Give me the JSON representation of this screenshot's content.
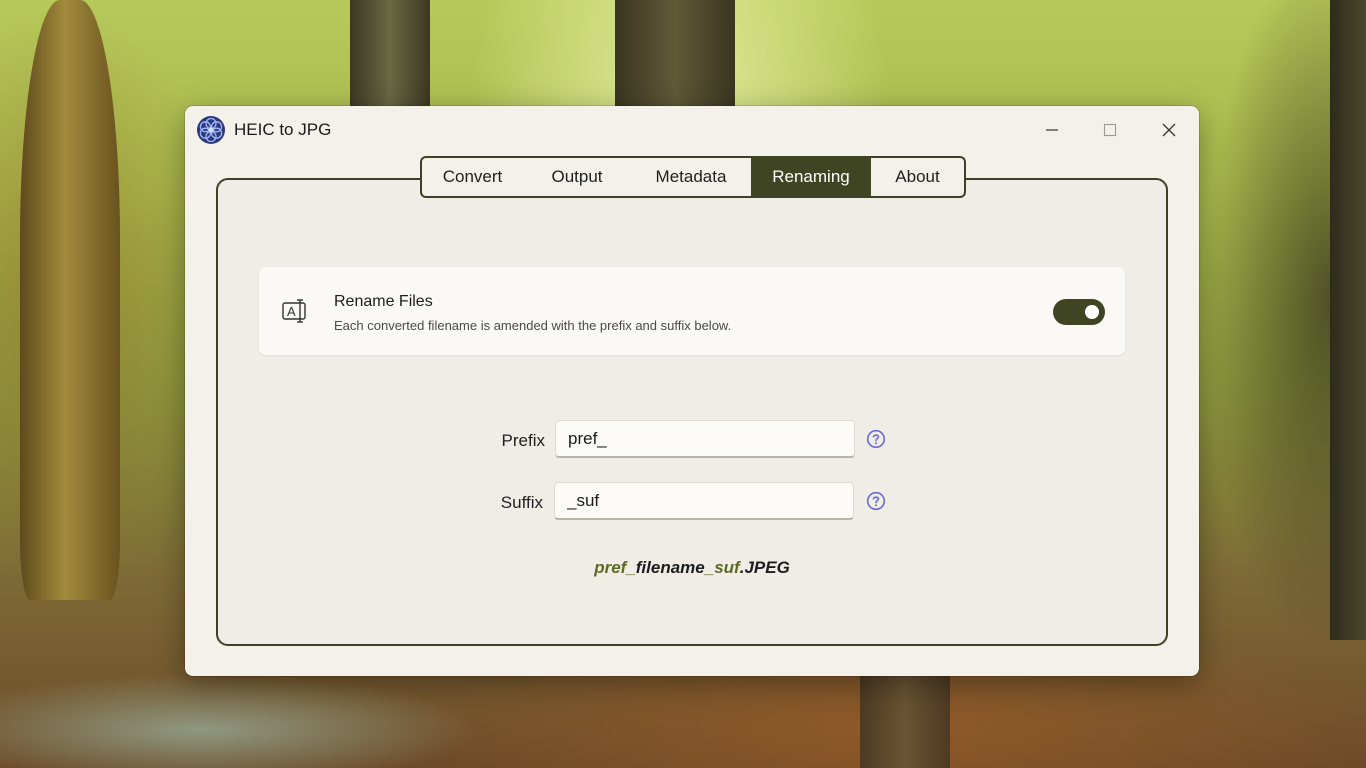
{
  "window": {
    "title": "HEIC to JPG",
    "app_icon": "flower-logo-icon",
    "controls": {
      "minimize_icon": "minimize-icon",
      "maximize_icon": "maximize-icon",
      "close_icon": "close-icon"
    }
  },
  "tabs": [
    {
      "label": "Convert",
      "active": false
    },
    {
      "label": "Output",
      "active": false
    },
    {
      "label": "Metadata",
      "active": false
    },
    {
      "label": "Renaming",
      "active": true
    },
    {
      "label": "About",
      "active": false
    }
  ],
  "rename_card": {
    "icon": "rename-text-icon",
    "title": "Rename Files",
    "description": "Each converted filename is amended with the prefix and suffix below.",
    "toggle_on": true
  },
  "prefix": {
    "label": "Prefix",
    "value": "pref_",
    "help_icon": "help-circle-icon"
  },
  "suffix": {
    "label": "Suffix",
    "value": "_suf",
    "help_icon": "help-circle-icon"
  },
  "preview": {
    "prefix": "pref_",
    "filename": "filename",
    "suffix": "_suf",
    "extension": ".JPEG"
  },
  "colors": {
    "accent": "#3f4522",
    "help": "#6a6ad0",
    "preview_accent": "#5c6a24"
  }
}
